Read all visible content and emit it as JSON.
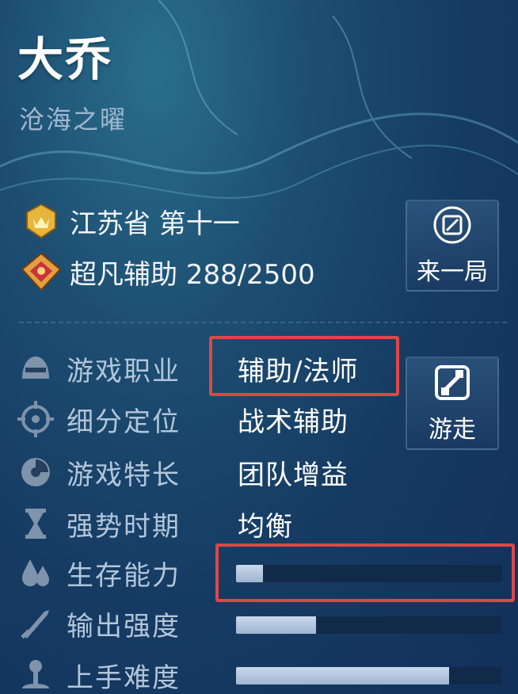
{
  "hero": {
    "name": "大乔",
    "skin": "沧海之曜"
  },
  "ranking": {
    "province": "江苏省 第十一",
    "rank": "超凡辅助 288/2500"
  },
  "buttons": {
    "play": "来一局",
    "roam": "游走"
  },
  "attributes": [
    {
      "label": "游戏职业",
      "value": "辅助/法师",
      "icon": "helmet-icon"
    },
    {
      "label": "细分定位",
      "value": "战术辅助",
      "icon": "crosshair-icon"
    },
    {
      "label": "游戏特长",
      "value": "团队增益",
      "icon": "clock-icon"
    },
    {
      "label": "强势时期",
      "value": "均衡",
      "icon": "hourglass-icon"
    }
  ],
  "stats": [
    {
      "label": "生存能力",
      "level": 0.1,
      "icon": "droplet-icon"
    },
    {
      "label": "输出强度",
      "level": 0.3,
      "icon": "sword-icon"
    },
    {
      "label": "上手难度",
      "level": 0.8,
      "icon": "joystick-icon"
    }
  ],
  "colors": {
    "highlight": "#e04646",
    "bar_fill": "#b4c6de",
    "bar_track": "#122a4a"
  }
}
